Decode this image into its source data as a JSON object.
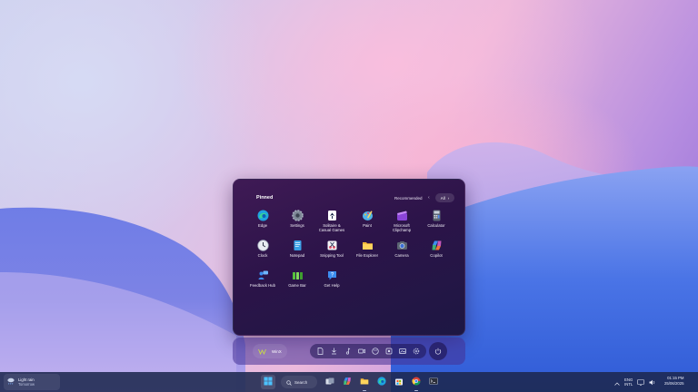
{
  "start_menu": {
    "pinned_title": "Pinned",
    "recommended_label": "Recommended",
    "all_label": "All",
    "apps": [
      {
        "label": "Edge",
        "icon": "edge-icon"
      },
      {
        "label": "Settings",
        "icon": "settings-icon"
      },
      {
        "label": "Solitaire &\nCasual Games",
        "icon": "solitaire-icon"
      },
      {
        "label": "Paint",
        "icon": "paint-icon"
      },
      {
        "label": "Microsoft\nClipchamp",
        "icon": "clipchamp-icon"
      },
      {
        "label": "Calculator",
        "icon": "calculator-icon"
      },
      {
        "label": "Clock",
        "icon": "clock-icon"
      },
      {
        "label": "Notepad",
        "icon": "notepad-icon"
      },
      {
        "label": "Snipping Tool",
        "icon": "snipping-tool-icon"
      },
      {
        "label": "File Explorer",
        "icon": "file-explorer-icon"
      },
      {
        "label": "Camera",
        "icon": "camera-icon"
      },
      {
        "label": "Copilot",
        "icon": "copilot-icon"
      },
      {
        "label": "Feedback Hub",
        "icon": "feedback-hub-icon"
      },
      {
        "label": "Game Bar",
        "icon": "game-bar-icon"
      },
      {
        "label": "Get Help",
        "icon": "get-help-icon"
      }
    ],
    "user_name": "WinX",
    "shortcuts": [
      "documents-icon",
      "downloads-icon",
      "music-icon",
      "videos-icon",
      "personalization-icon",
      "network-icon",
      "pictures-icon",
      "settings-icon"
    ]
  },
  "taskbar": {
    "weather": {
      "condition": "Light rain",
      "subtitle": "Tomorrow"
    },
    "search_label": "Search",
    "pinned": [
      "task-view-icon",
      "copilot-icon",
      "file-explorer-icon",
      "edge-icon",
      "store-icon",
      "chrome-icon",
      "terminal-icon"
    ],
    "language": {
      "lang": "ENG",
      "layout": "INTL"
    },
    "time": "01:15 PM",
    "date": "25/06/2025"
  },
  "colors": {
    "accent": "#4c8ef7",
    "start_bg": "#2c1449",
    "taskbar_bg": "#1c284e"
  }
}
